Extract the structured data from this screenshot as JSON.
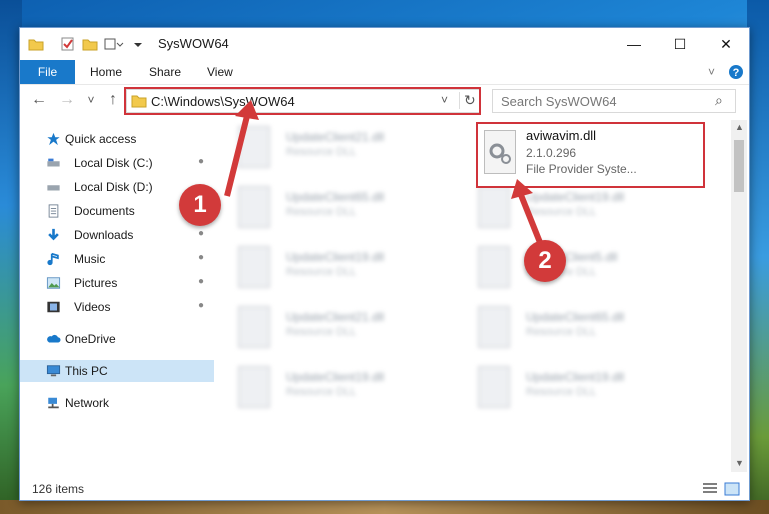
{
  "window": {
    "title": "SysWOW64",
    "minimize": "—",
    "maximize": "☐",
    "close": "✕"
  },
  "ribbon": {
    "tabs": [
      "File",
      "Home",
      "Share",
      "View"
    ]
  },
  "nav": {
    "back": "←",
    "forward": "→",
    "recent": "˅",
    "up": "↑"
  },
  "address": {
    "path": "C:\\Windows\\SysWOW64",
    "refresh": "↻",
    "dropdown": "˅"
  },
  "search": {
    "placeholder": "Search SysWOW64",
    "icon": "⌕"
  },
  "sidebar": {
    "items": [
      {
        "label": "Quick access",
        "icon": "star-icon",
        "pinned": false
      },
      {
        "label": "Local Disk (C:)",
        "icon": "drive-icon",
        "pinned": true
      },
      {
        "label": "Local Disk (D:)",
        "icon": "drive-icon",
        "pinned": false
      },
      {
        "label": "Documents",
        "icon": "documents-icon",
        "pinned": true
      },
      {
        "label": "Downloads",
        "icon": "download-icon",
        "pinned": true
      },
      {
        "label": "Music",
        "icon": "music-icon",
        "pinned": true
      },
      {
        "label": "Pictures",
        "icon": "pictures-icon",
        "pinned": true
      },
      {
        "label": "Videos",
        "icon": "videos-icon",
        "pinned": true
      },
      {
        "label": "OneDrive",
        "icon": "cloud-icon",
        "pinned": false
      },
      {
        "label": "This PC",
        "icon": "computer-icon",
        "pinned": false
      },
      {
        "label": "Network",
        "icon": "network-icon",
        "pinned": false
      }
    ],
    "pin_glyph": "📌"
  },
  "files": {
    "left_column": [
      {
        "name": "UpdateClient21.dll",
        "type": "Resource DLL"
      },
      {
        "name": "UpdateClient65.dll",
        "type": "Resource DLL"
      },
      {
        "name": "UpdateClient19.dll",
        "type": "Resource DLL"
      },
      {
        "name": "UpdateClient21.dll",
        "type": "Resource DLL"
      },
      {
        "name": "UpdateClient19.dll",
        "type": "Resource DLL"
      }
    ],
    "right_column": [
      {
        "name": "UpdateClient19.dll",
        "type": "Resource DLL"
      },
      {
        "name": "UpdateClient5.dll",
        "type": "Resource DLL"
      },
      {
        "name": "UpdateClient65.dll",
        "type": "Resource DLL"
      },
      {
        "name": "UpdateClient19.dll",
        "type": "Resource DLL"
      }
    ],
    "selected": {
      "name": "aviwavim.dll",
      "version": "2.1.0.296",
      "description": "File Provider Syste..."
    }
  },
  "status": {
    "count": "126 items"
  },
  "annotations": {
    "step1": "1",
    "step2": "2",
    "color": "#d23a3a"
  }
}
